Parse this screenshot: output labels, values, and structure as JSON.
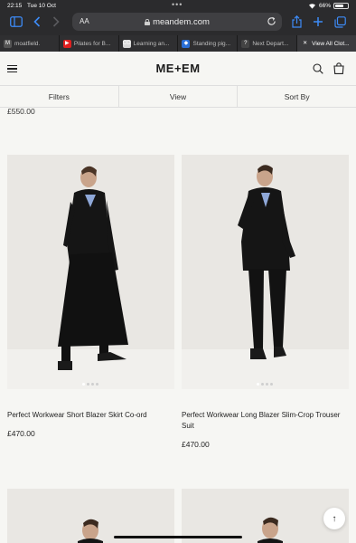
{
  "status_bar": {
    "time": "22:15",
    "date": "Tue 10 Oct",
    "battery_text": "66%",
    "battery_level": 0.66
  },
  "browser": {
    "text_size_label": "AA",
    "url": "meandem.com",
    "accent_color": "#3d8bf7",
    "tabs": [
      {
        "label": "moatfield.",
        "favicon": "M",
        "color": "#555555"
      },
      {
        "label": "Pilates for B...",
        "favicon": "▶",
        "color": "#e02020"
      },
      {
        "label": "Learning an...",
        "favicon": "CO",
        "color": "#d8d8d8"
      },
      {
        "label": "Standing pig...",
        "favicon": "◆",
        "color": "#2a6fd6"
      },
      {
        "label": "Next Depart...",
        "favicon": "?",
        "color": "#444444"
      },
      {
        "label": "View All Clot...",
        "favicon": "✕",
        "color": "#3b3b3e"
      }
    ],
    "active_tab_index": 5
  },
  "site": {
    "logo": "ME+EM"
  },
  "filter_bar": {
    "filters": "Filters",
    "view": "View",
    "sort_by": "Sort By"
  },
  "previous_row_price": "£550.00",
  "products": [
    {
      "title": "Perfect Workwear Short Blazer Skirt Co-ord",
      "price": "£470.00",
      "image_pages": 4,
      "current_page": 1
    },
    {
      "title": "Perfect Workwear Long Blazer Slim-Crop Trouser Suit",
      "price": "£470.00",
      "image_pages": 4,
      "current_page": 1
    }
  ],
  "scroll_top_icon": "arrow-up-icon"
}
